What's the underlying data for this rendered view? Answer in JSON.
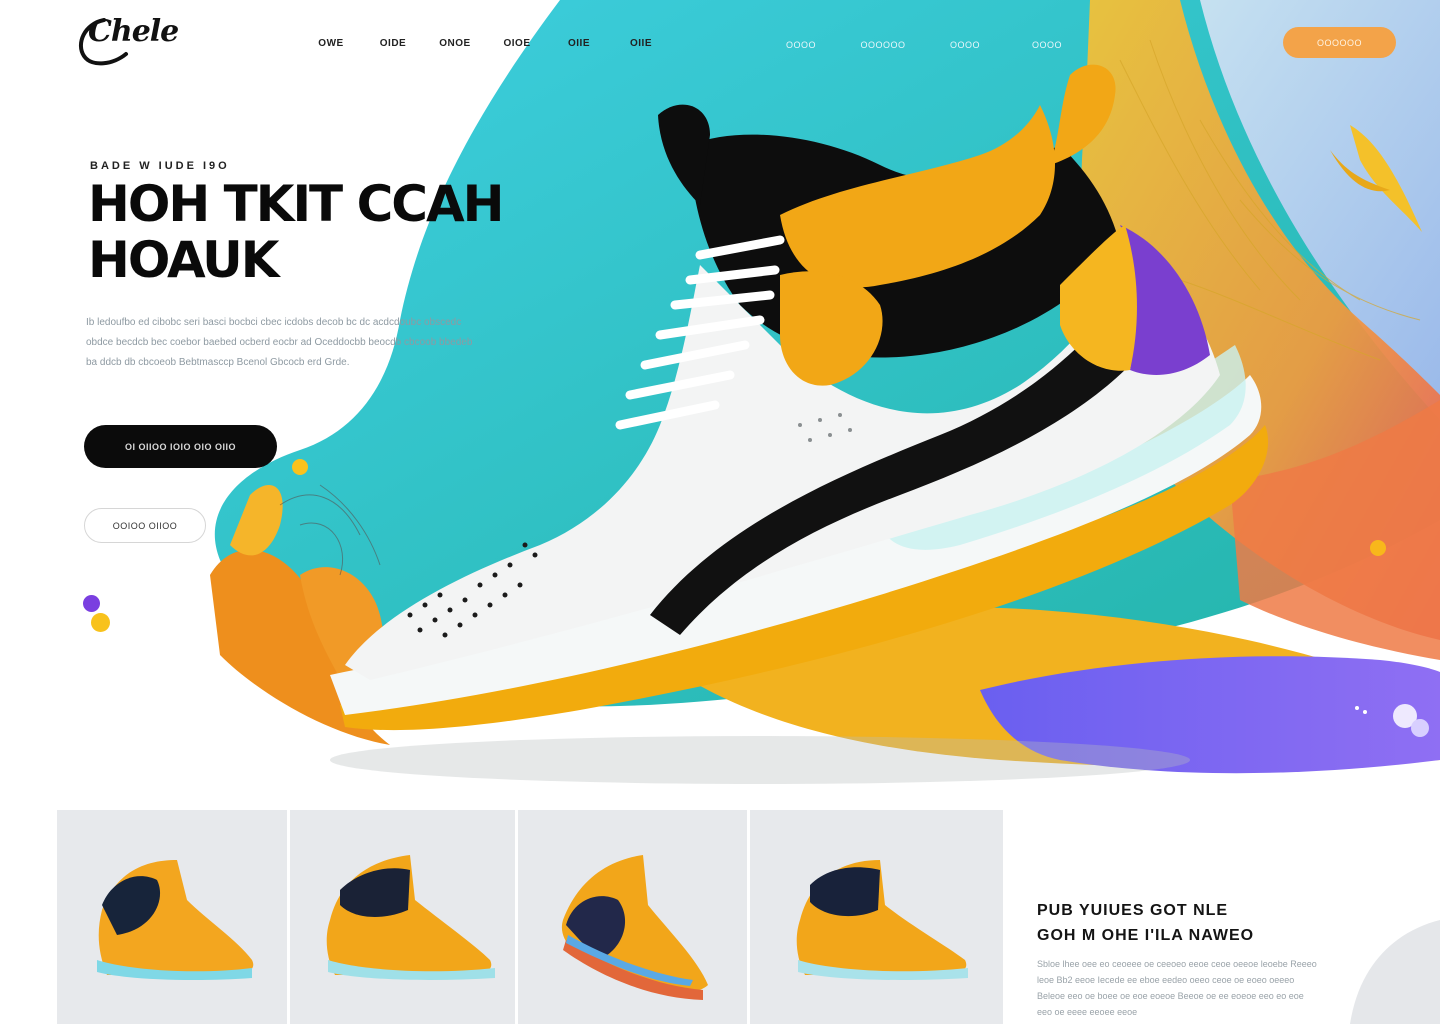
{
  "brand": {
    "logo_text": "Chele"
  },
  "nav": {
    "left_items": [
      "OWE",
      "OIDE",
      "ONOE",
      "OIOE",
      "OIIE",
      "OIIE"
    ],
    "right_items": [
      "OOOO",
      "OOOOOO",
      "OOOO",
      "OOOO"
    ],
    "cta_label": "OOOOOO"
  },
  "hero": {
    "eyebrow": "BADE W IUDE I9O",
    "headline_line1": "HOH TKIT CCAH",
    "headline_line2": "HOAUK",
    "description": "Ib ledoufbo ed cibobc seri basci bocbci cbec icdobs decob bc dc acdcdoubc obscedc obdce becdcb bec coebor baebed ocberd eocbr ad Oceddocbb beocdb cbcoob bbedeb ba ddcb db cbcoeob Bebtmasccp Bcenol Gbcocb erd Grde.",
    "primary_button_label": "OI OIIOO  IOIO OIO OIIO",
    "secondary_button_label": "OOIOO   OIIOO"
  },
  "products": [
    {
      "name": "product-1"
    },
    {
      "name": "product-2"
    },
    {
      "name": "product-3"
    },
    {
      "name": "product-4"
    }
  ],
  "feature": {
    "title_line1": "PUB YUIUES GOT NLE",
    "title_line2": "GOH M OHE I'ILA NAWEO",
    "description": "Sbloe lhee oee eo ceoeee oe ceeoeo eeoe ceoe oeeoe leoebe Reeeo leoe Bb2 eeoe Iecede ee eboe eedeo oeeo ceoe oe eoeo oeeeo Beleoe eeo oe boee oe eoe eoeoe Beeoe oe ee eoeoe eeo eo eoe eeo oe eeee eeoee eeoe"
  },
  "colors": {
    "teal": "#2fbec6",
    "orange": "#f3a349",
    "yellow": "#f5b820",
    "purple": "#7d5ae6",
    "black": "#0b0b0b"
  }
}
